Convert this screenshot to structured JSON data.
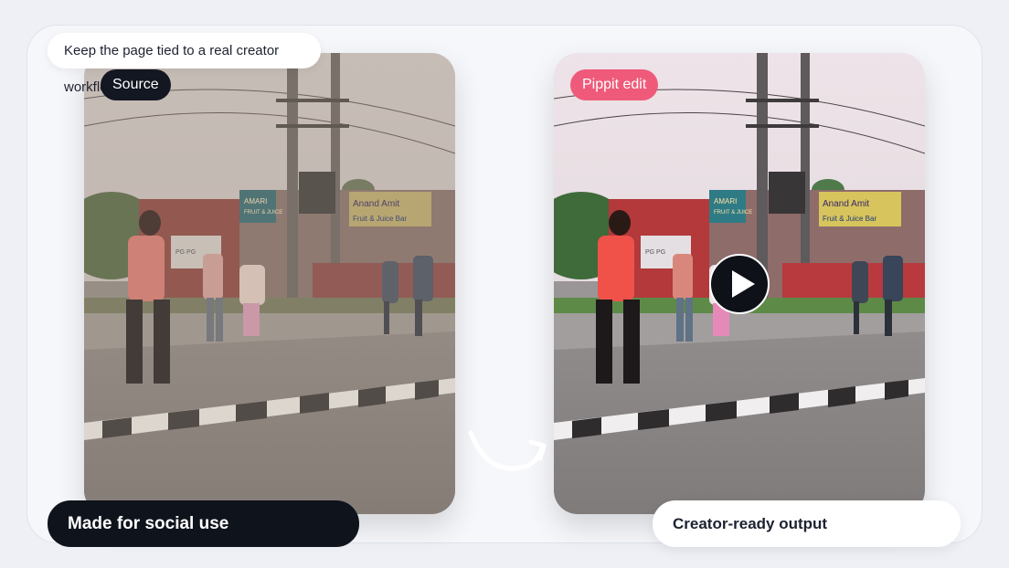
{
  "callout": {
    "text": "Keep the page tied to a real creator workflow"
  },
  "source_card": {
    "label": "Source",
    "label_color": "#121722"
  },
  "output_card": {
    "label": "Pippit edit",
    "label_color": "#ef5a7a"
  },
  "badges": {
    "left": "Made for social use",
    "right": "Creator-ready output"
  },
  "play_button": {
    "icon": "play-icon"
  },
  "connector": {
    "icon": "curved-arrow-icon"
  },
  "scene_signs": {
    "shop_left_1": "AMARI",
    "shop_left_2": "FRUIT & JUICE",
    "shop_right_1": "Anand Amit",
    "shop_right_2": "Fruit & Juice Bar",
    "poster": "PG PG"
  }
}
